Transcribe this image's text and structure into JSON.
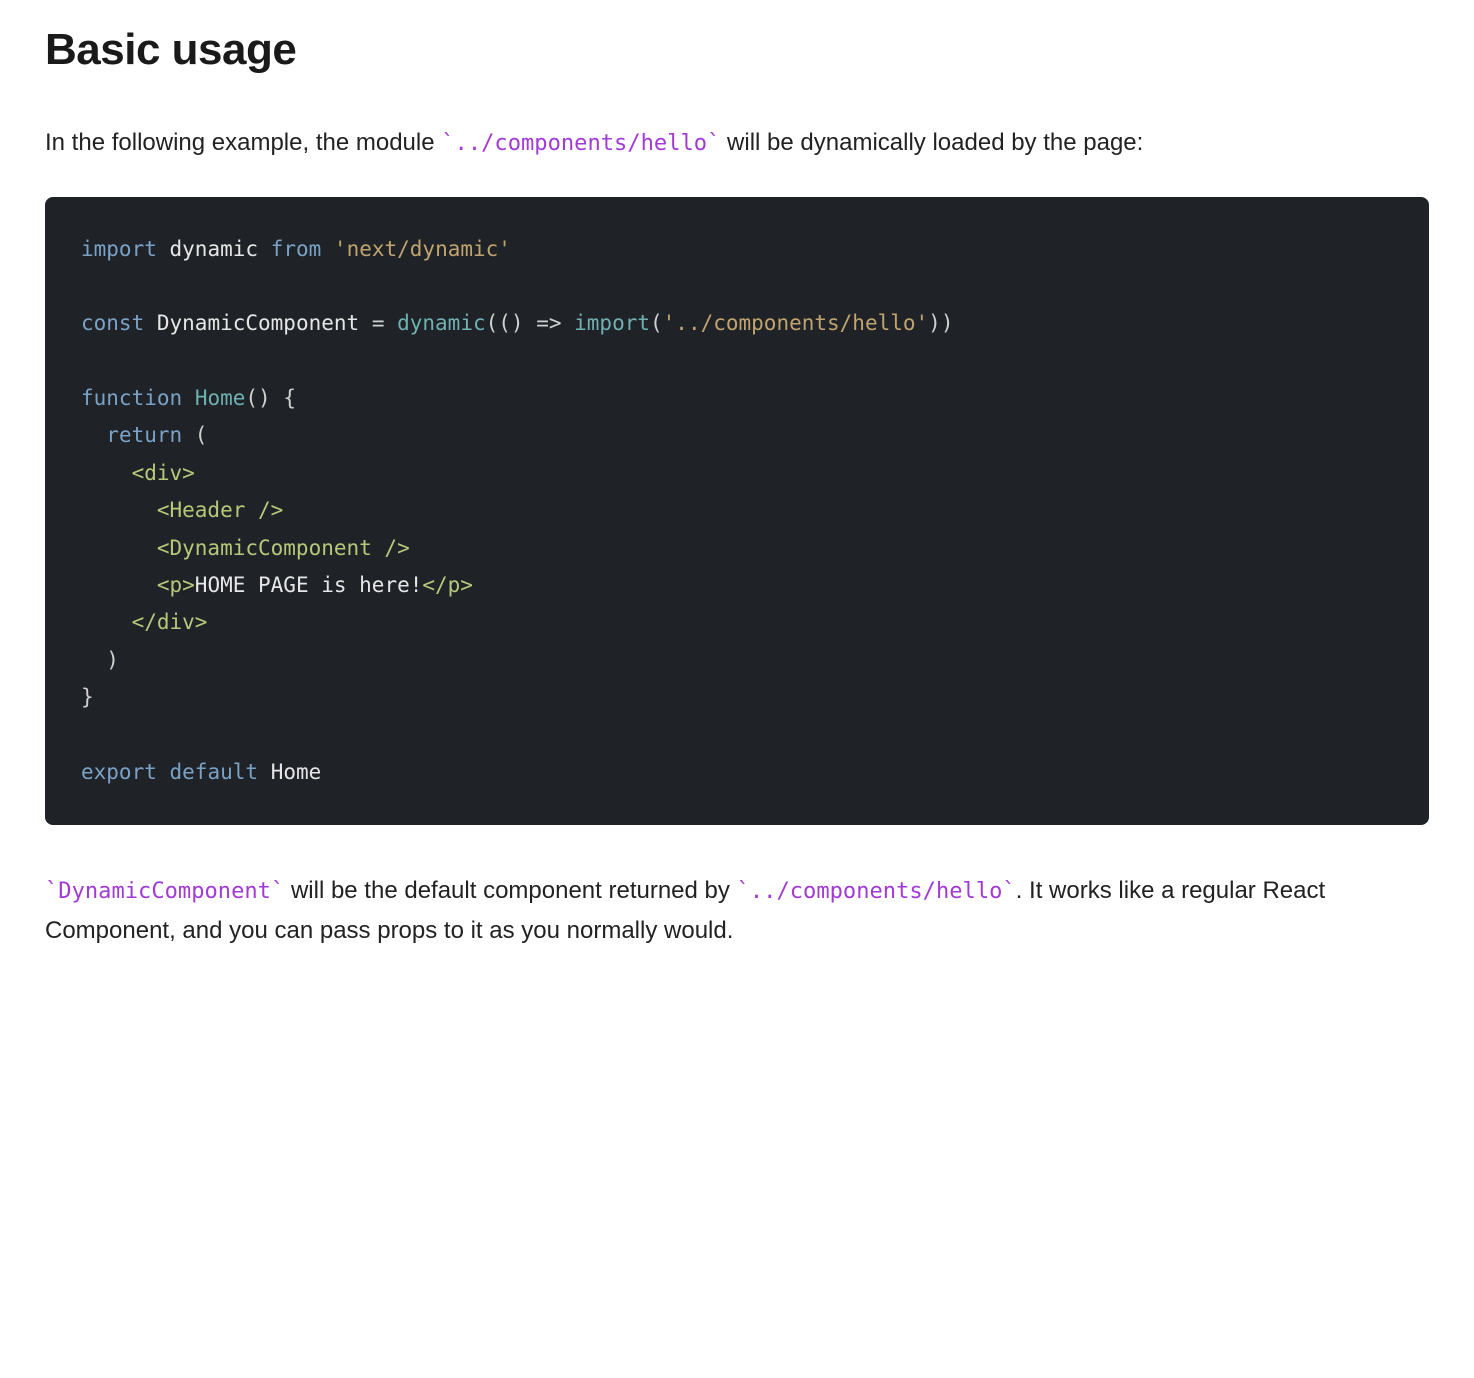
{
  "heading": "Basic usage",
  "intro": {
    "before_code": "In the following example, the module ",
    "module_path": "../components/hello",
    "after_code": " will be dynamically loaded by the page:"
  },
  "code": {
    "kw_import": "import",
    "id_dynamic": "dynamic",
    "kw_from": "from",
    "str_next_dynamic": "'next/dynamic'",
    "kw_const": "const",
    "id_DynComp": "DynamicComponent",
    "op_eq": " = ",
    "fn_dynamic": "dynamic",
    "paren_open": "(",
    "arrow_fn_open": "() => ",
    "fn_import": "import",
    "str_path": "'../components/hello'",
    "paren_close2": "))",
    "kw_function": "function",
    "fn_Home": "Home",
    "fn_Home_sig": "() {",
    "kw_return": "return",
    "return_tail": " (",
    "jsx_div_open": "<div>",
    "jsx_header": "<Header />",
    "jsx_dyncomp": "<DynamicComponent />",
    "jsx_p_open": "<p>",
    "jsx_p_text": "HOME PAGE is here!",
    "jsx_p_close": "</p>",
    "jsx_div_close": "</div>",
    "close_paren": ")",
    "close_brace": "}",
    "kw_export": "export",
    "kw_default": "default",
    "id_Home2": "Home"
  },
  "outro": {
    "code1": "DynamicComponent",
    "mid1": " will be the default component returned by ",
    "code2": "../components/hello",
    "mid2": ". It works like a regular React Component, and you can pass props to it as you normally would."
  }
}
